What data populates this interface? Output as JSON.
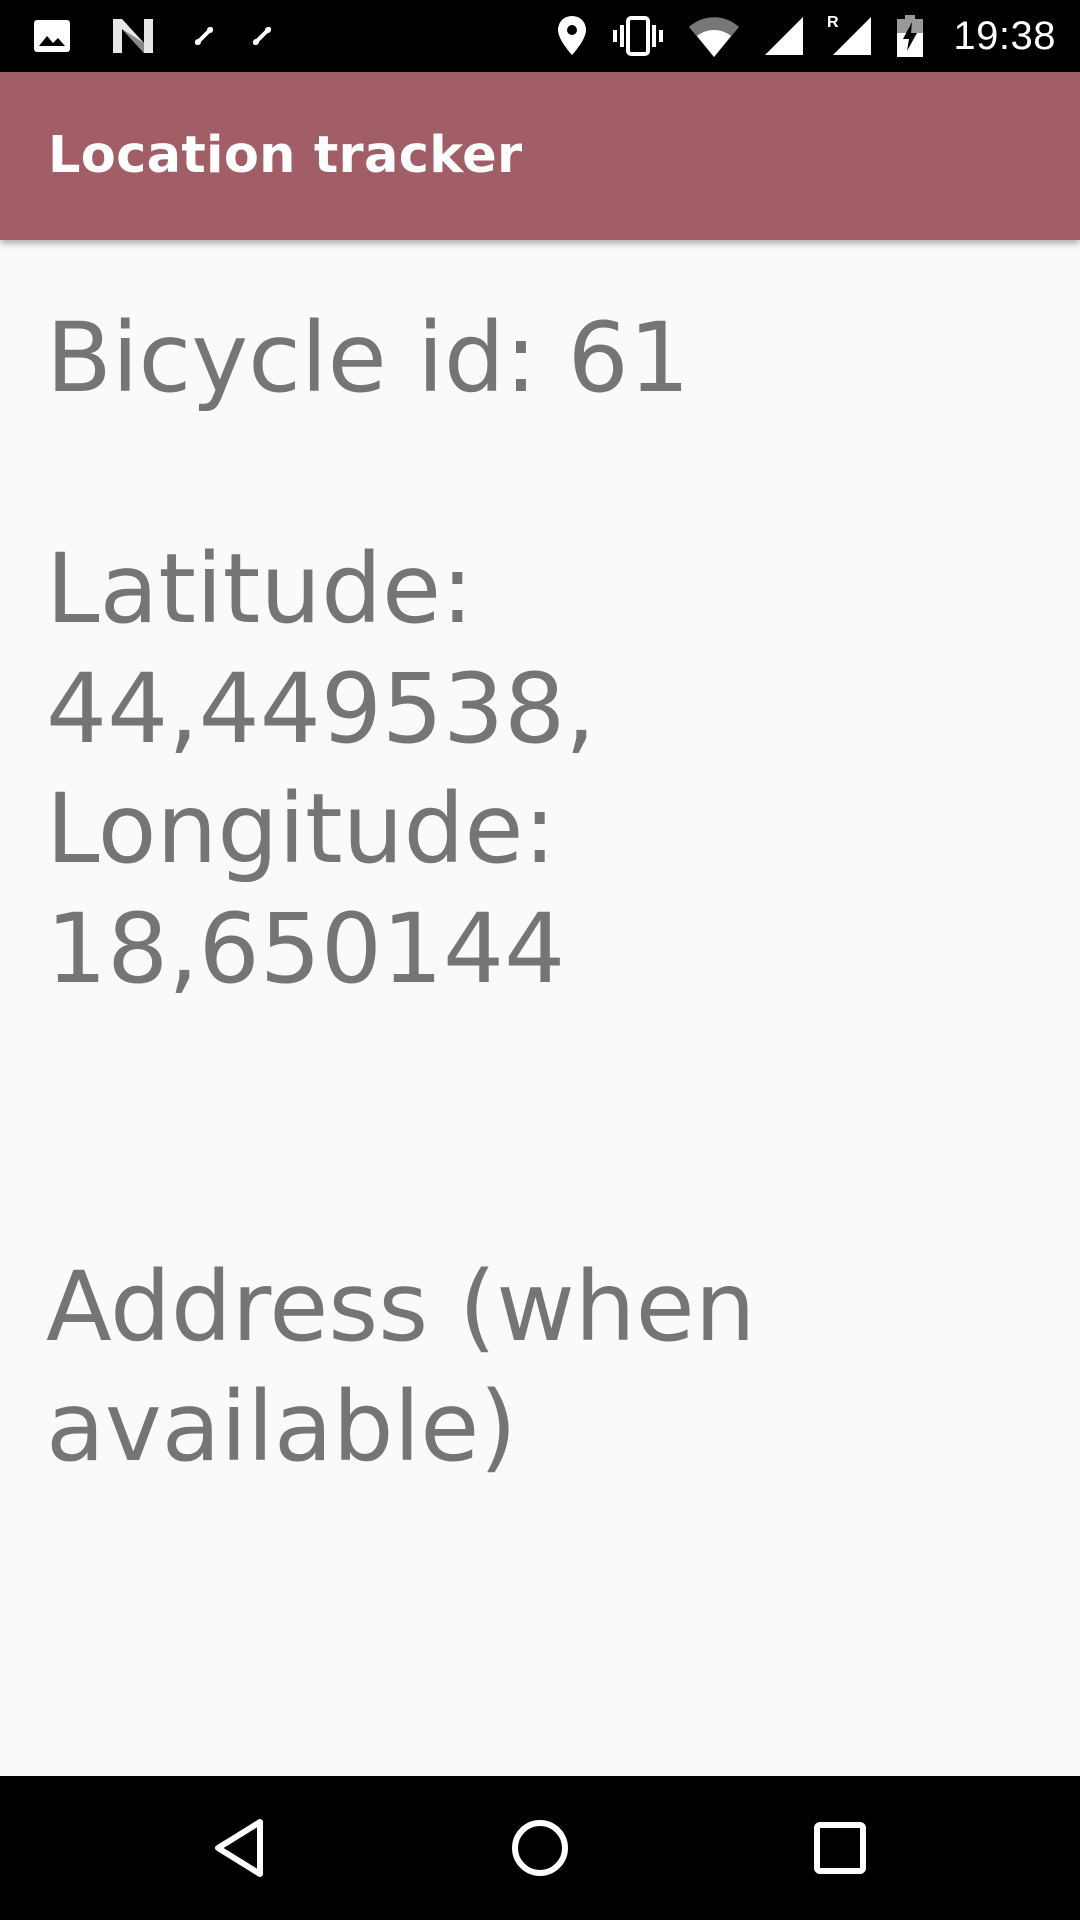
{
  "status_bar": {
    "time": "19:38",
    "left_icons": [
      "image-icon",
      "n-logo-icon",
      "usb-debug-icon",
      "usb-debug-icon"
    ],
    "right_icons": [
      "location-pin-icon",
      "vibrate-icon",
      "wifi-icon",
      "signal-icon",
      "roaming-signal-icon",
      "battery-charging-icon"
    ],
    "roaming_label": "R"
  },
  "app_bar": {
    "title": "Location tracker",
    "color": "#a25e66"
  },
  "main": {
    "bicycle_text": "Bicycle id: 61",
    "coordinates_text": "Latitude: 44,449538,\nLongitude:\n18,650144",
    "address_text": "Address (when\navailable)",
    "text_color": "#757575"
  },
  "nav_bar": {
    "buttons": [
      "back-icon",
      "home-icon",
      "recents-icon"
    ]
  }
}
